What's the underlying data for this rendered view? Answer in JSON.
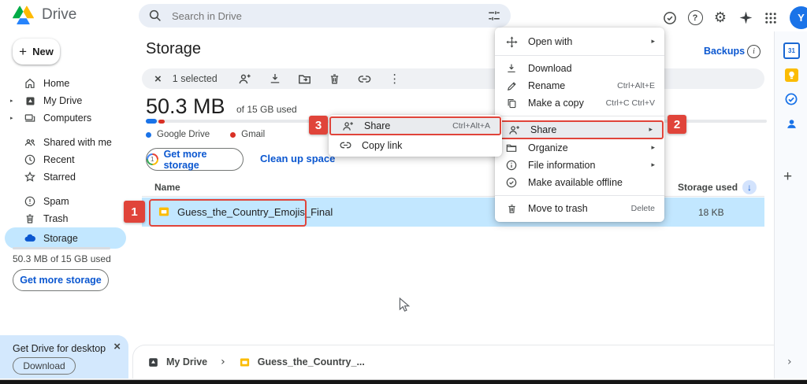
{
  "header": {
    "app_name": "Drive",
    "search_placeholder": "Search in Drive",
    "avatar_initial": "Y"
  },
  "sidebar": {
    "new_label": "New",
    "items": [
      {
        "label": "Home"
      },
      {
        "label": "My Drive"
      },
      {
        "label": "Computers"
      },
      {
        "label": "Shared with me"
      },
      {
        "label": "Recent"
      },
      {
        "label": "Starred"
      },
      {
        "label": "Spam"
      },
      {
        "label": "Trash"
      },
      {
        "label": "Storage",
        "selected": true
      }
    ],
    "storage_summary": "50.3 MB of 15 GB used",
    "get_more_storage": "Get more storage",
    "promo": {
      "title": "Get Drive for desktop",
      "download": "Download"
    }
  },
  "main": {
    "title": "Storage",
    "backups_label": "Backups",
    "toolbar": {
      "selected_count": "1 selected"
    },
    "usage": {
      "amount": "50.3 MB",
      "detail": "of 15 GB used"
    },
    "legend": [
      {
        "label": "Google Drive",
        "color": "#1a73e8"
      },
      {
        "label": "Gmail",
        "color": "#ea4335"
      }
    ],
    "get_more_storage": "Get more storage",
    "clean_up": "Clean up space",
    "table": {
      "name_header": "Name",
      "storage_header": "Storage used"
    },
    "row": {
      "name": "Guess_the_Country_Emojis_Final",
      "storage": "18 KB"
    },
    "breadcrumb": {
      "root": "My Drive",
      "file": "Guess_the_Country_..."
    }
  },
  "context_menu": {
    "items": [
      {
        "label": "Open with"
      },
      {
        "label": "Download"
      },
      {
        "label": "Rename",
        "shortcut": "Ctrl+Alt+E"
      },
      {
        "label": "Make a copy",
        "shortcut": "Ctrl+C Ctrl+V"
      },
      {
        "label": "Share",
        "highlighted": true
      },
      {
        "label": "Organize"
      },
      {
        "label": "File information"
      },
      {
        "label": "Make available offline"
      },
      {
        "label": "Move to trash",
        "shortcut": "Delete"
      }
    ]
  },
  "submenu": {
    "items": [
      {
        "label": "Share",
        "shortcut": "Ctrl+Alt+A",
        "highlighted": true
      },
      {
        "label": "Copy link"
      }
    ]
  },
  "annotations": {
    "step1": "1",
    "step2": "2",
    "step3": "3"
  },
  "icons": {
    "close": "×",
    "more_vertical": "⋮",
    "gear": "⚙",
    "menu_arrow": "▸",
    "expand": "▸",
    "crumb_arrow": "›",
    "panel_arrow": "›",
    "sort_arrow": "↓",
    "plus": "+",
    "help": "?",
    "info": "i",
    "one": "1",
    "calendar_day": "31"
  },
  "colors": {
    "annotation_red": "#e0443a",
    "selection_blue": "#c2e7ff",
    "link_blue": "#0b57d0",
    "avatar_blue": "#1a73e8",
    "drive_blue": "#1a73e8",
    "gmail_red": "#d93025"
  }
}
